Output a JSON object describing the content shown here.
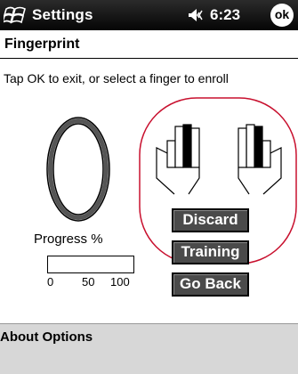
{
  "titlebar": {
    "title": "Settings",
    "time": "6:23",
    "ok_label": "ok"
  },
  "page": {
    "heading": "Fingerprint",
    "instruction": "Tap OK to exit, or select a finger to enroll"
  },
  "progress": {
    "label": "Progress %",
    "value": 0,
    "scale": [
      "0",
      "50",
      "100"
    ]
  },
  "hands": {
    "left": {
      "selected_finger": 3
    },
    "right": {
      "selected_finger": 2
    }
  },
  "buttons": {
    "discard": "Discard",
    "training": "Training",
    "go_back": "Go Back"
  },
  "menubar": {
    "label": "About Options"
  },
  "colors": {
    "selection_outline": "#c8102e",
    "button_fill": "#4a4a4a"
  }
}
